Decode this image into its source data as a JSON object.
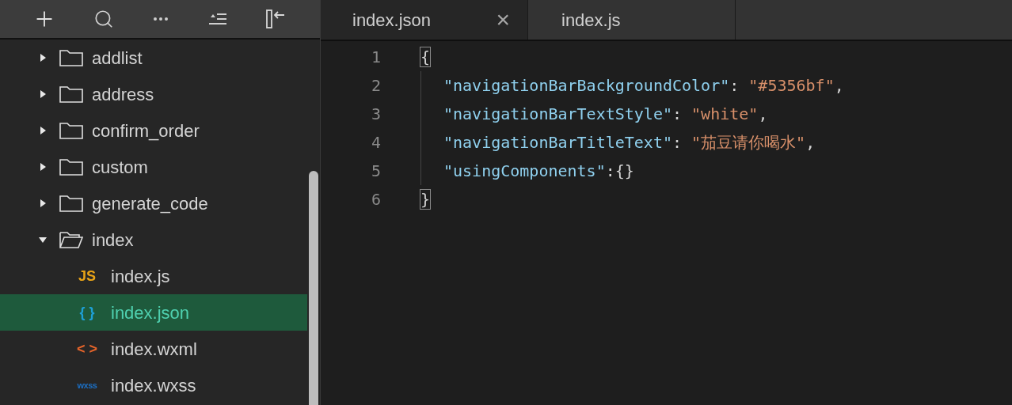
{
  "toolbar": {
    "buttons": [
      {
        "kind": "add"
      },
      {
        "kind": "search"
      },
      {
        "kind": "more"
      },
      {
        "kind": "collapse"
      },
      {
        "kind": "hide-panel"
      }
    ]
  },
  "tree": {
    "items": [
      {
        "kind": "folder",
        "name": "addlist",
        "expanded": false,
        "selected": false
      },
      {
        "kind": "folder",
        "name": "address",
        "expanded": false,
        "selected": false
      },
      {
        "kind": "folder",
        "name": "confirm_order",
        "expanded": false,
        "selected": false
      },
      {
        "kind": "folder",
        "name": "custom",
        "expanded": false,
        "selected": false
      },
      {
        "kind": "folder",
        "name": "generate_code",
        "expanded": false,
        "selected": false
      },
      {
        "kind": "folder",
        "name": "index",
        "expanded": true,
        "selected": false,
        "children": [
          {
            "kind": "file",
            "icon": "JS",
            "color": "#e8a317",
            "name": "index.js",
            "selected": false
          },
          {
            "kind": "file",
            "icon": "{ }",
            "color": "#1ea0d6",
            "name": "index.json",
            "selected": true
          },
          {
            "kind": "file",
            "icon": "< >",
            "color": "#e8652a",
            "name": "index.wxml",
            "selected": false
          },
          {
            "kind": "file",
            "icon": "wxss",
            "color": "#1c6fc4",
            "name": "index.wxss",
            "selected": false
          }
        ]
      }
    ]
  },
  "tabs": [
    {
      "label": "index.json",
      "selected": true,
      "close": "×"
    },
    {
      "label": "index.js",
      "selected": false
    }
  ],
  "editor": {
    "lines": [
      {
        "number": "1",
        "tokens": [
          {
            "kind": "bracket-match",
            "text": "{"
          }
        ]
      },
      {
        "number": "2",
        "tokens": [
          {
            "kind": "key",
            "text": "\"navigationBarBackgroundColor\""
          },
          {
            "kind": "punct",
            "text": ": "
          },
          {
            "kind": "string",
            "text": "\"#5356bf\""
          },
          {
            "kind": "punct",
            "text": ","
          }
        ]
      },
      {
        "number": "3",
        "tokens": [
          {
            "kind": "key",
            "text": "\"navigationBarTextStyle\""
          },
          {
            "kind": "punct",
            "text": ": "
          },
          {
            "kind": "string",
            "text": "\"white\""
          },
          {
            "kind": "punct",
            "text": ","
          }
        ]
      },
      {
        "number": "4",
        "tokens": [
          {
            "kind": "key",
            "text": "\"navigationBarTitleText\""
          },
          {
            "kind": "punct",
            "text": ": "
          },
          {
            "kind": "string",
            "text": "\"茄豆请你喝水\""
          },
          {
            "kind": "punct",
            "text": ","
          }
        ]
      },
      {
        "number": "5",
        "tokens": [
          {
            "kind": "key",
            "text": "\"usingComponents\""
          },
          {
            "kind": "punct",
            "text": ":{}"
          }
        ]
      },
      {
        "number": "6",
        "tokens": [
          {
            "kind": "bracket-match",
            "text": "}"
          }
        ]
      }
    ]
  }
}
